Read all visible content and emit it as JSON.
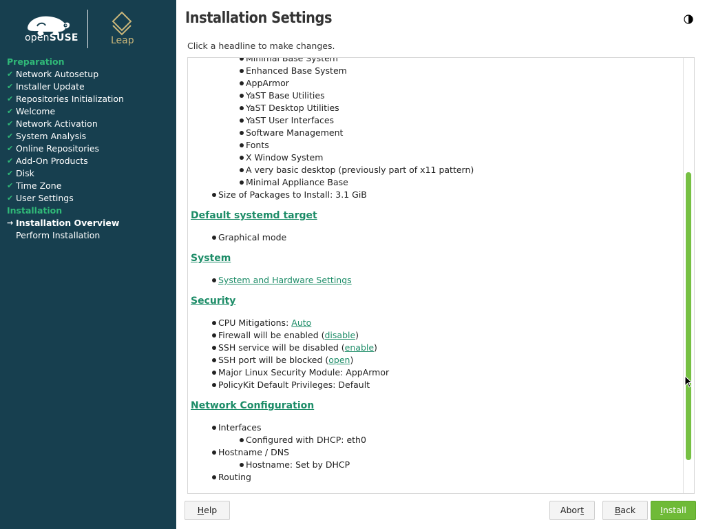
{
  "sidebar": {
    "logo_text_open": "open",
    "logo_text_suse": "SUSE",
    "leap_text": "Leap",
    "preparation_title": "Preparation",
    "preparation_steps": [
      "Network Autosetup",
      "Installer Update",
      "Repositories Initialization",
      "Welcome",
      "Network Activation",
      "System Analysis",
      "Online Repositories",
      "Add-On Products",
      "Disk",
      "Time Zone",
      "User Settings"
    ],
    "installation_title": "Installation",
    "current_step": "Installation Overview",
    "pending_step": "Perform Installation",
    "done_mark": "✔",
    "current_mark": "→"
  },
  "main": {
    "title": "Installation Settings",
    "hint": "Click a headline to make changes.",
    "software_patterns": [
      "Minimal Base System",
      "Enhanced Base System",
      "AppArmor",
      "YaST Base Utilities",
      "YaST Desktop Utilities",
      "YaST User Interfaces",
      "Software Management",
      "Fonts",
      "X Window System",
      "A very basic desktop (previously part of x11 pattern)",
      "Minimal Appliance Base"
    ],
    "packages_size": "Size of Packages to Install: 3.1 GiB",
    "systemd": {
      "heading": "Default systemd target",
      "value": "Graphical mode"
    },
    "system": {
      "heading": "System",
      "link": "System and Hardware Settings"
    },
    "security": {
      "heading": "Security",
      "cpu_label": "CPU Mitigations: ",
      "cpu_link": "Auto",
      "firewall_label": "Firewall will be enabled (",
      "firewall_link": "disable",
      "ssh_service_label": "SSH service will be disabled (",
      "ssh_service_link": "enable",
      "ssh_port_label": "SSH port will be blocked (",
      "ssh_port_link": "open",
      "close_paren": ")",
      "lsm": "Major Linux Security Module: AppArmor",
      "polkit": "PolicyKit Default Privileges: Default"
    },
    "network": {
      "heading": "Network Configuration",
      "interfaces": "Interfaces",
      "dhcp": "Configured with DHCP: eth0",
      "hostname_dns": "Hostname / DNS",
      "hostname": "Hostname: Set by DHCP",
      "routing": "Routing"
    }
  },
  "buttons": {
    "help_u": "H",
    "help_rest": "elp",
    "abort_pre": "Abor",
    "abort_u": "t",
    "back_u": "B",
    "back_rest": "ack",
    "install_u": "I",
    "install_rest": "nstall"
  },
  "colors": {
    "sidebar_bg": "#173f4f",
    "accent_green": "#30ba78",
    "link": "#1c8c67",
    "install_button": "#6fba37",
    "scroll_thumb": "#76c043"
  }
}
